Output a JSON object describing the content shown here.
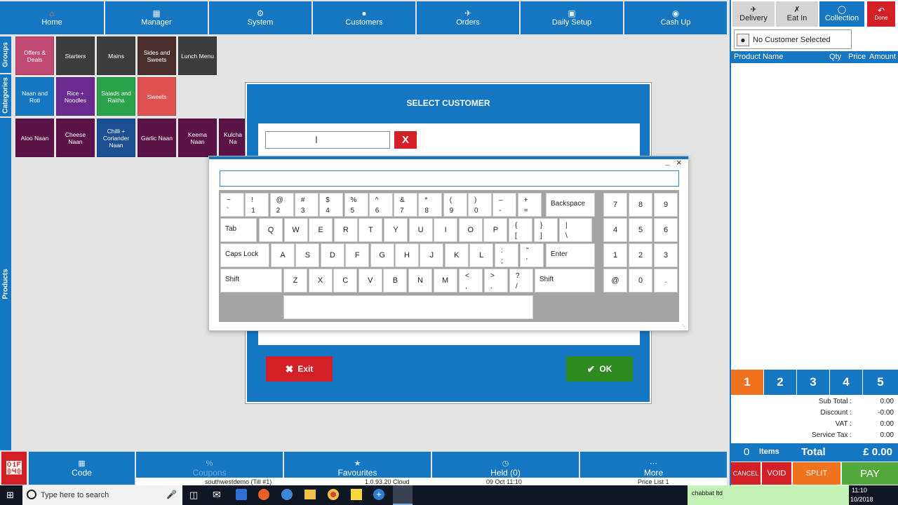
{
  "nav": [
    {
      "label": "Home",
      "icon": "home-icon"
    },
    {
      "label": "Manager",
      "icon": "calculator-icon"
    },
    {
      "label": "System",
      "icon": "gears-icon"
    },
    {
      "label": "Customers",
      "icon": "user-icon"
    },
    {
      "label": "Orders",
      "icon": "moped-icon"
    },
    {
      "label": "Daily Setup",
      "icon": "calendar-icon"
    },
    {
      "label": "Cash Up",
      "icon": "money-bag-icon"
    }
  ],
  "side_tabs": {
    "groups": "Groups",
    "categories": "Categories",
    "products": "Products"
  },
  "groups": [
    {
      "label": "Offers & Deals",
      "color": "#c04a73"
    },
    {
      "label": "Starters",
      "color": "#3d3d3d"
    },
    {
      "label": "Mains",
      "color": "#3d3d3d"
    },
    {
      "label": "Sides and Sweets",
      "color": "#4a2e2e"
    },
    {
      "label": "Lunch Menu",
      "color": "#3d3d3d"
    }
  ],
  "categories": [
    {
      "label": "Naan and Roti",
      "color": "#1576c2"
    },
    {
      "label": "Rice + Noodles",
      "color": "#6a2b8e"
    },
    {
      "label": "Salads and Raitha",
      "color": "#2aa34a"
    },
    {
      "label": "Sweets",
      "color": "#e05252"
    }
  ],
  "products": [
    {
      "label": "Aloo Naan",
      "color": "#5b1247"
    },
    {
      "label": "Cheese Naan",
      "color": "#5b1247"
    },
    {
      "label": "Chilli + Coriander Naan",
      "color": "#1a4f93"
    },
    {
      "label": "Garlic Naan",
      "color": "#5b1247"
    },
    {
      "label": "Keema Naan",
      "color": "#5b1247"
    },
    {
      "label": "Kulcha Na",
      "color": "#5b1247"
    }
  ],
  "order_types": {
    "delivery": "Delivery",
    "eat_in": "Eat In",
    "collection": "Collection",
    "done": "Done"
  },
  "customer": {
    "label": "No Customer Selected"
  },
  "order_table": {
    "columns": [
      "Product Name",
      "Qty",
      "Price",
      "Amount"
    ]
  },
  "number_tabs": [
    "1",
    "2",
    "3",
    "4",
    "5"
  ],
  "summary": [
    {
      "label": "Sub Total :",
      "value": "0.00"
    },
    {
      "label": "Discount :",
      "value": "-0.00"
    },
    {
      "label": "VAT :",
      "value": "0.00"
    },
    {
      "label": "Service Tax :",
      "value": "0.00"
    }
  ],
  "totals": {
    "items_count": "0",
    "items_label": "Items",
    "total_label": "Total",
    "total_value": "£ 0.00"
  },
  "actions": {
    "cancel": "CANCEL",
    "void": "VOID",
    "split": "SPLIT",
    "pay": "PAY"
  },
  "bottom": [
    {
      "label": "Code",
      "icon": "calculator-icon"
    },
    {
      "label": "Coupons",
      "icon": "percent-icon"
    },
    {
      "label": "Favourites",
      "icon": "star-icon"
    },
    {
      "label": "Held (0)",
      "icon": "clock-icon"
    },
    {
      "label": "More",
      "icon": "more-icon"
    }
  ],
  "status": {
    "till": "southwestdemo (Till #1)",
    "version": "1.0.93.20 Cloud",
    "datetime": "09 Oct 11:10",
    "price_list": "Price List 1"
  },
  "taskbar": {
    "search_placeholder": "Type here to search",
    "notification": "chabbat ltd",
    "clock_time": "11:10",
    "clock_date": "10/2018"
  },
  "dialog": {
    "title": "SELECT CUSTOMER",
    "clear_label": "X",
    "exit_label": "Exit",
    "ok_label": "OK"
  },
  "keyboard": {
    "minimize": "_",
    "close": "×",
    "row1": [
      {
        "top": "~",
        "bottom": "`"
      },
      {
        "top": "!",
        "bottom": "1"
      },
      {
        "top": "@",
        "bottom": "2"
      },
      {
        "top": "#",
        "bottom": "3"
      },
      {
        "top": "$",
        "bottom": "4"
      },
      {
        "top": "%",
        "bottom": "5"
      },
      {
        "top": "^",
        "bottom": "6"
      },
      {
        "top": "&",
        "bottom": "7"
      },
      {
        "top": "*",
        "bottom": "8"
      },
      {
        "top": "(",
        "bottom": "9"
      },
      {
        "top": ")",
        "bottom": "0"
      },
      {
        "top": "–",
        "bottom": "-"
      },
      {
        "top": "+",
        "bottom": "="
      }
    ],
    "backspace": "Backspace",
    "tab": "Tab",
    "row2": [
      "Q",
      "W",
      "E",
      "R",
      "T",
      "Y",
      "U",
      "I",
      "O",
      "P"
    ],
    "row2_extra": [
      {
        "top": "{",
        "bottom": "["
      },
      {
        "top": "}",
        "bottom": "]"
      },
      {
        "top": "|",
        "bottom": "\\"
      }
    ],
    "caps": "Caps Lock",
    "row3": [
      "A",
      "S",
      "D",
      "F",
      "G",
      "H",
      "J",
      "K",
      "L"
    ],
    "row3_extra": [
      {
        "top": ":",
        "bottom": ";"
      },
      {
        "top": "\"",
        "bottom": "'"
      }
    ],
    "enter": "Enter",
    "shift": "Shift",
    "row4": [
      "Z",
      "X",
      "C",
      "V",
      "B",
      "N",
      "M"
    ],
    "row4_extra": [
      {
        "top": "<",
        "bottom": ","
      },
      {
        "top": ">",
        "bottom": "."
      },
      {
        "top": "?",
        "bottom": "/"
      }
    ],
    "numpad": [
      [
        "7",
        "8",
        "9"
      ],
      [
        "4",
        "5",
        "6"
      ],
      [
        "1",
        "2",
        "3"
      ],
      [
        "@",
        "0",
        "."
      ]
    ]
  }
}
